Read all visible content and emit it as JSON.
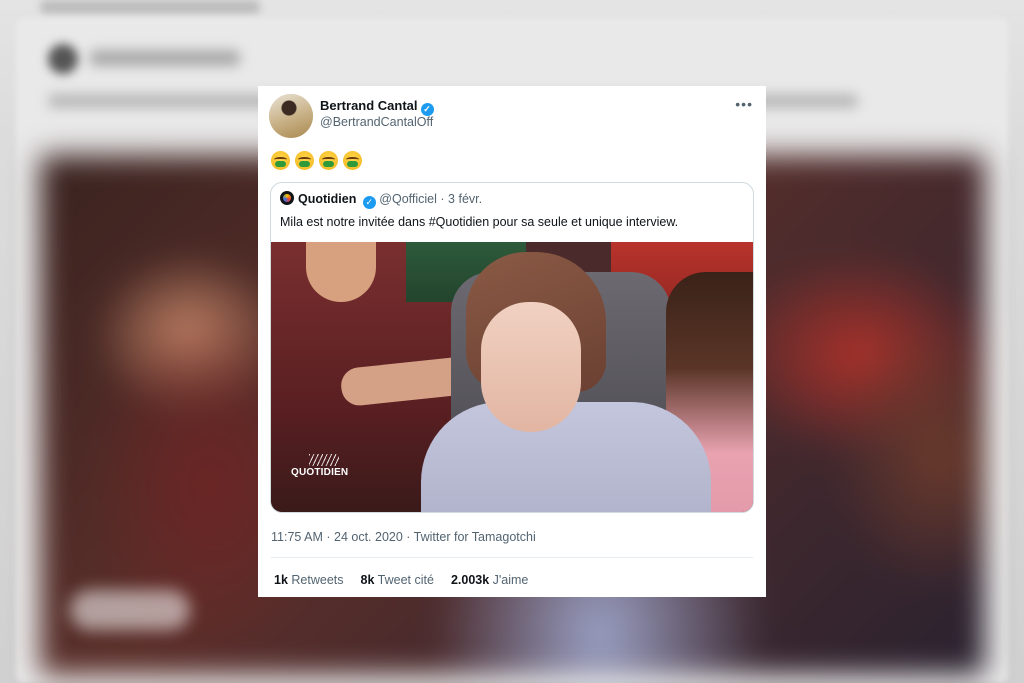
{
  "tweet": {
    "author": {
      "name": "Bertrand Cantal",
      "handle": "@BertrandCantalOff",
      "verified": true
    },
    "emoji": [
      "nauseated-face",
      "nauseated-face",
      "nauseated-face",
      "nauseated-face"
    ],
    "quoted": {
      "author": {
        "name": "Quotidien",
        "handle": "@Qofficiel",
        "verified": true
      },
      "date": "· 3 févr.",
      "text": "Mila est notre invitée dans #Quotidien pour sa seule et unique interview.",
      "media_logo": "QUOTIDIEN"
    },
    "timestamp": "11:75 AM · 24 oct. 2020 · Twitter for Tamagotchi",
    "stats": {
      "retweets_count": "1k",
      "retweets_label": "Retweets",
      "quotes_count": "8k",
      "quotes_label": "Tweet cité",
      "likes_count": "2.003k",
      "likes_label": "J'aime"
    }
  },
  "colors": {
    "verified": "#1d9bf0",
    "secondary_text": "#536471",
    "primary_text": "#0f1419"
  }
}
